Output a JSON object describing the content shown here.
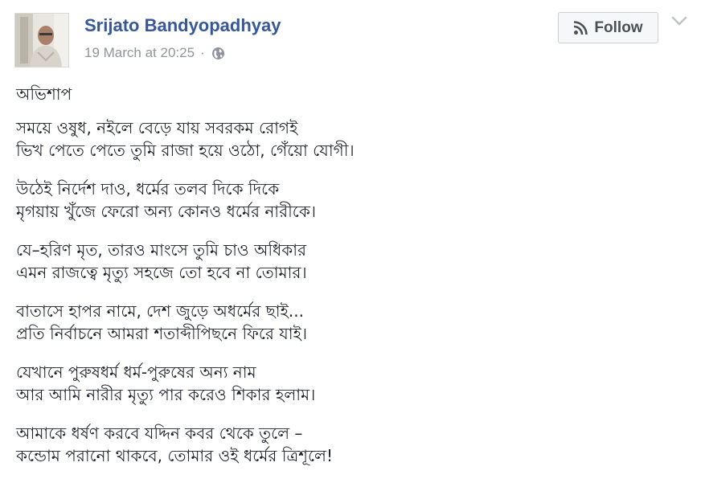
{
  "author": {
    "name": "Srijato Bandyopadhyay",
    "avatar_icon": "profile-photo"
  },
  "meta": {
    "timestamp": "19 March at 20:25",
    "separator": "·",
    "privacy_icon": "globe-icon"
  },
  "actions": {
    "follow_label": "Follow",
    "follow_icon": "rss-icon",
    "menu_icon": "chevron-down-icon"
  },
  "post": {
    "title": "অভিশাপ",
    "stanzas": [
      [
        "সময়ে ওষুধ, নইলে বেড়ে যায় সবরকম রোগই",
        "ভিখ পেতে পেতে তুমি রাজা হয়ে ওঠো, গেঁয়ো যোগী।"
      ],
      [
        "উঠেই নির্দেশ দাও, ধর্মের তলব দিকে দিকে",
        "মৃগয়ায় খুঁজে ফেরো অন্য কোনও ধর্মের নারীকে।"
      ],
      [
        "যে–হরিণ মৃত, তারও মাংসে তুমি চাও অধিকার",
        "এমন রাজত্বে মৃত্যু সহজে তো হবে না তোমার।"
      ],
      [
        "বাতাসে হাপর নামে, দেশ জুড়ে অধর্মের ছাই...",
        "প্রতি নির্বাচনে আমরা শতাব্দীপিছনে ফিরে যাই।"
      ],
      [
        "যেখানে পুরুষধর্ম ধর্ম-পুরুষের অন্য নাম",
        "আর আমি নারীর মৃত্যু পার করেও শিকার হলাম।"
      ],
      [
        "আমাকে ধর্ষণ করবে যদ্দিন কবর থেকে তুলে –",
        "কন্ডোম পরানো থাকবে, তোমার ওই ধর্মের ত্রিশূলে!"
      ]
    ]
  },
  "colors": {
    "name_link": "#365899",
    "meta_text": "#90949c",
    "body_text": "#1d2129",
    "button_bg": "#f6f7f9",
    "button_border": "#ced0d4",
    "button_text": "#4b4f56"
  }
}
